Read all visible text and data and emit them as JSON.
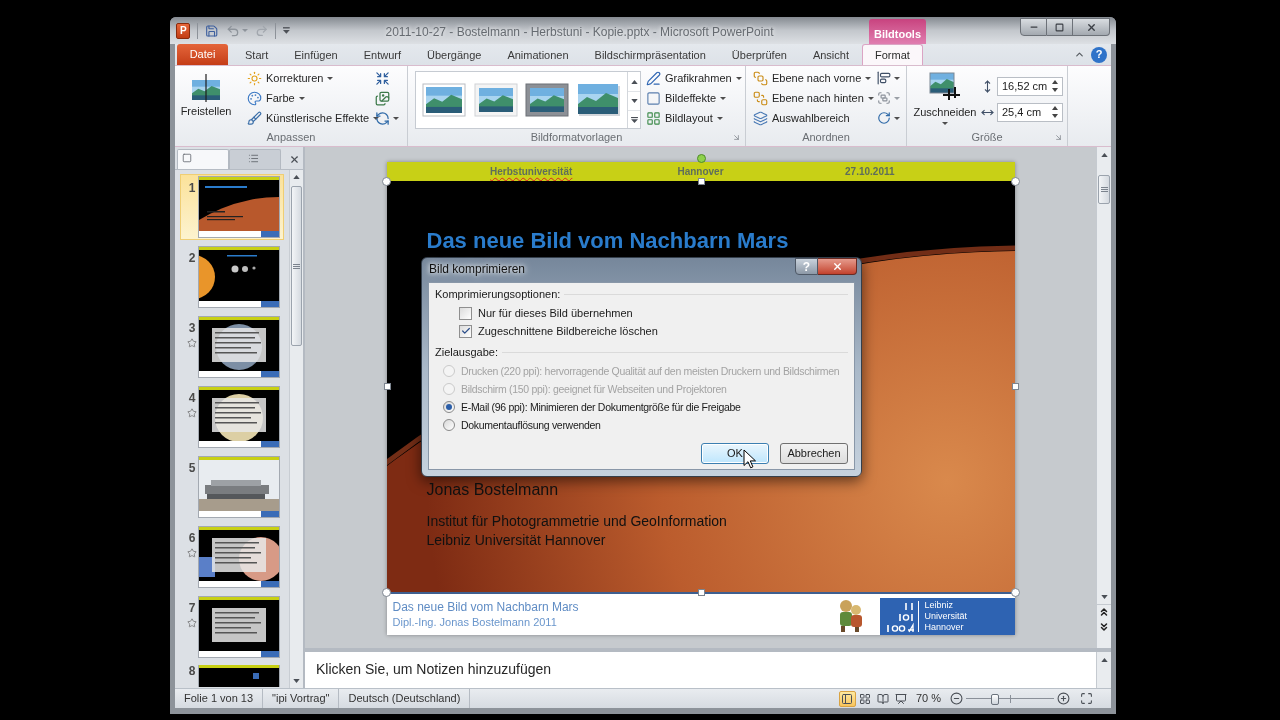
{
  "window": {
    "title": "2011-10-27 - Bostelmann - Herbstuni - Kopie.pptx - Microsoft PowerPoint",
    "app_icon": "P",
    "context_tab_header": "Bildtools"
  },
  "ribbon_tabs": [
    {
      "label": "Datei",
      "kind": "file",
      "selected": false
    },
    {
      "label": "Start",
      "kind": "tab",
      "selected": false
    },
    {
      "label": "Einfügen",
      "kind": "tab",
      "selected": false
    },
    {
      "label": "Entwurf",
      "kind": "tab",
      "selected": false
    },
    {
      "label": "Übergänge",
      "kind": "tab",
      "selected": false
    },
    {
      "label": "Animationen",
      "kind": "tab",
      "selected": false
    },
    {
      "label": "Bildschirmpräsentation",
      "kind": "tab",
      "selected": false
    },
    {
      "label": "Überprüfen",
      "kind": "tab",
      "selected": false
    },
    {
      "label": "Ansicht",
      "kind": "tab",
      "selected": false
    },
    {
      "label": "Format",
      "kind": "context",
      "selected": true
    }
  ],
  "ribbon_help": "?",
  "ribbon": {
    "adjust": {
      "label": "Anpassen",
      "dialog_launcher": false,
      "big_button": "Freistellen",
      "items": [
        {
          "label": "Korrekturen",
          "dropdown": true
        },
        {
          "label": "Farbe",
          "dropdown": true
        },
        {
          "label": "Künstlerische Effekte",
          "dropdown": true
        }
      ]
    },
    "picture_styles": {
      "label": "Bildformatvorlagen",
      "dialog_launcher": true,
      "items": [
        {
          "label": "Grafikrahmen",
          "dropdown": true
        },
        {
          "label": "Bildeffekte",
          "dropdown": true
        },
        {
          "label": "Bildlayout",
          "dropdown": true
        }
      ]
    },
    "arrange": {
      "label": "Anordnen",
      "dialog_launcher": false,
      "items": [
        {
          "label": "Ebene nach vorne",
          "dropdown": true
        },
        {
          "label": "Ebene nach hinten",
          "dropdown": true
        },
        {
          "label": "Auswahlbereich",
          "dropdown": false
        }
      ]
    },
    "size": {
      "label": "Größe",
      "dialog_launcher": true,
      "big_button": "Zuschneiden",
      "fields": [
        {
          "kind": "height",
          "value": "16,52 cm"
        },
        {
          "kind": "width",
          "value": "25,4 cm"
        }
      ]
    }
  },
  "slides_panel": {
    "tabs": [
      {
        "kind": "slides",
        "selected": true
      },
      {
        "kind": "outline",
        "selected": false
      }
    ],
    "slides": [
      {
        "number": "1",
        "kind": "title",
        "selected": true,
        "animated": false
      },
      {
        "number": "2",
        "kind": "planets",
        "selected": false,
        "animated": false
      },
      {
        "number": "3",
        "kind": "text-earth",
        "selected": false,
        "animated": true
      },
      {
        "number": "4",
        "kind": "text-moon",
        "selected": false,
        "animated": true
      },
      {
        "number": "5",
        "kind": "photo",
        "selected": false,
        "animated": false
      },
      {
        "number": "6",
        "kind": "text-mars",
        "selected": false,
        "animated": true
      },
      {
        "number": "7",
        "kind": "text-dark",
        "selected": false,
        "animated": true
      },
      {
        "number": "8",
        "kind": "dark",
        "selected": false,
        "animated": false
      }
    ]
  },
  "slide": {
    "header": [
      {
        "text": "Herbstuniversität",
        "misspelled": true
      },
      {
        "text": "Hannover",
        "misspelled": false
      },
      {
        "text": "27.10.2011",
        "misspelled": false
      }
    ],
    "title": "Das neue Bild vom Nachbarn Mars",
    "author": "Jonas Bostelmann",
    "affiliation": [
      "Institut für Photogrammetrie und GeoInformation",
      "Leibniz Universität Hannover"
    ],
    "footer": {
      "title": "Das neue Bild vom Nachbarn Mars",
      "subtitle": "Dipl.-Ing. Jonas Bostelmann 2011",
      "logo_text": [
        "Leibniz",
        "Universität",
        "Hannover"
      ]
    }
  },
  "notes": {
    "placeholder": "Klicken Sie, um Notizen hinzuzufügen"
  },
  "status_bar": {
    "items": [
      "Folie 1 von 13",
      "\"ipi Vortrag\"",
      "Deutsch (Deutschland)"
    ],
    "views": [
      {
        "kind": "normal",
        "selected": true
      },
      {
        "kind": "sorter",
        "selected": false
      },
      {
        "kind": "reading",
        "selected": false
      },
      {
        "kind": "slideshow",
        "selected": false
      }
    ],
    "zoom": "70 %",
    "zoom_slider": {
      "level": 0.33
    }
  },
  "dialog": {
    "title": "Bild komprimieren",
    "help": "?",
    "sections": [
      {
        "label": "Komprimierungsoptionen:",
        "options": [
          {
            "kind": "checkbox",
            "label": "Nur für dieses Bild übernehmen",
            "checked": false
          },
          {
            "kind": "checkbox",
            "label": "Zugeschnittene Bildbereiche löschen",
            "checked": true
          }
        ]
      },
      {
        "label": "Zielausgabe:",
        "options": [
          {
            "kind": "radio",
            "label": "Drucken (220 ppi): hervorragende Qualität auf den meisten Druckern und Bildschirmen",
            "selected": false,
            "disabled": true
          },
          {
            "kind": "radio",
            "label": "Bildschirm (150 ppi): geeignet für Webseiten und Projektoren",
            "selected": false,
            "disabled": true
          },
          {
            "kind": "radio",
            "label": "E-Mail (96 ppi): Minimieren der Dokumentgröße für die Freigabe",
            "selected": true,
            "disabled": false
          },
          {
            "kind": "radio",
            "label": "Dokumentauflösung verwenden",
            "selected": false,
            "disabled": false
          }
        ]
      }
    ],
    "buttons": [
      {
        "label": "OK",
        "highlighted": true
      },
      {
        "label": "Abbrechen",
        "highlighted": false
      }
    ]
  }
}
